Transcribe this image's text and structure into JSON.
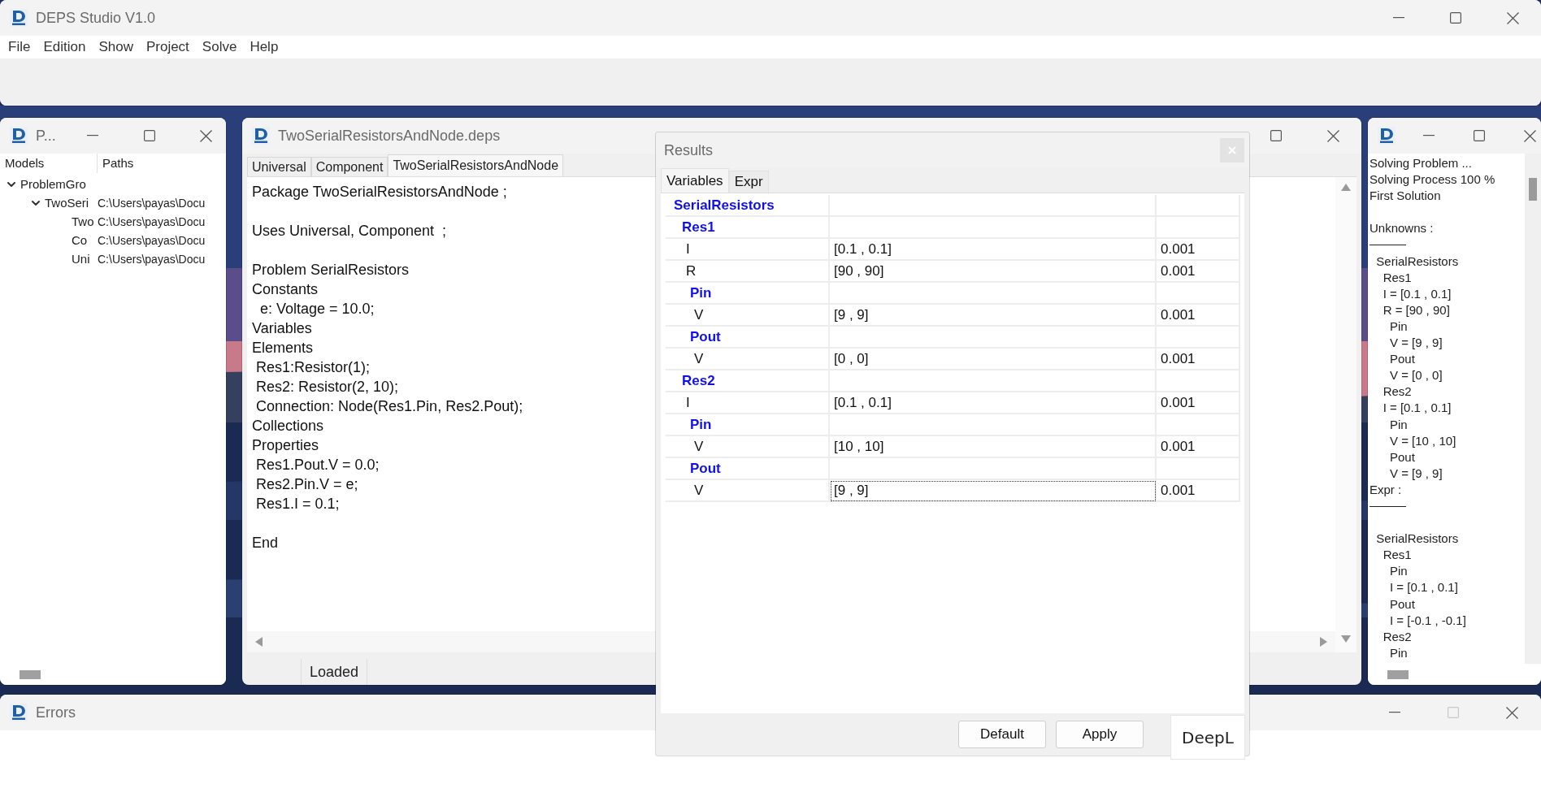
{
  "app": {
    "title": "DEPS Studio V1.0",
    "controls": [
      {
        "kind": "minimize",
        "disabled": false
      },
      {
        "kind": "maximize",
        "disabled": false
      },
      {
        "kind": "close",
        "disabled": false
      }
    ],
    "menu": [
      "File",
      "Edition",
      "Show",
      "Project",
      "Solve",
      "Help"
    ]
  },
  "project_window": {
    "title": "P...",
    "controls": [
      {
        "kind": "minimize",
        "disabled": false
      },
      {
        "kind": "maximize",
        "disabled": false
      },
      {
        "kind": "close",
        "disabled": false
      }
    ],
    "columns": [
      "Models",
      "Paths"
    ],
    "tree": [
      {
        "label": "ProblemGro",
        "expanded": true,
        "children": [
          {
            "label": "TwoSeri",
            "path": "C:\\Users\\payas\\Docu",
            "expanded": true,
            "children": [
              {
                "label": "Two",
                "path": "C:\\Users\\payas\\Docu"
              },
              {
                "label": "Co",
                "path": "C:\\Users\\payas\\Docu"
              },
              {
                "label": "Uni",
                "path": "C:\\Users\\payas\\Docu"
              }
            ]
          }
        ]
      }
    ]
  },
  "editor_window": {
    "title": "TwoSerialResistorsAndNode.deps",
    "controls": [
      {
        "kind": "maximize",
        "disabled": false
      },
      {
        "kind": "close",
        "disabled": false
      }
    ],
    "tabs": [
      {
        "label": "Universal",
        "selected": false
      },
      {
        "label": "Component",
        "selected": false
      },
      {
        "label": "TwoSerialResistorsAndNode",
        "selected": true
      }
    ],
    "code": [
      {
        "kind": "code",
        "text": "Package TwoSerialResistorsAndNode ;"
      },
      {
        "kind": "blank"
      },
      {
        "kind": "code",
        "text": "Uses Universal, Component  ;"
      },
      {
        "kind": "blank"
      },
      {
        "kind": "code",
        "text": "Problem SerialResistors"
      },
      {
        "kind": "code",
        "text": "Constants"
      },
      {
        "kind": "code",
        "text": "  e: Voltage = 10.0;"
      },
      {
        "kind": "code",
        "text": "Variables"
      },
      {
        "kind": "code",
        "text": "Elements"
      },
      {
        "kind": "code",
        "text": " Res1:Resistor(1);"
      },
      {
        "kind": "code",
        "text": " Res2: Resistor(2, 10);"
      },
      {
        "kind": "code",
        "text": " Connection: Node(Res1.Pin, Res2.Pout);"
      },
      {
        "kind": "code",
        "text": "Collections"
      },
      {
        "kind": "code",
        "text": "Properties"
      },
      {
        "kind": "code",
        "text": " Res1.Pout.V = 0.0;"
      },
      {
        "kind": "code",
        "text": " Res2.Pin.V = e;"
      },
      {
        "kind": "code",
        "text": " Res1.I = 0.1;"
      },
      {
        "kind": "blank"
      },
      {
        "kind": "code",
        "text": "End"
      }
    ],
    "status": "Loaded"
  },
  "results_dialog": {
    "title": "Results",
    "tabs": [
      {
        "label": "Variables",
        "selected": true
      },
      {
        "label": "Expr",
        "selected": false
      }
    ],
    "rows": [
      {
        "kind": "group",
        "name": "SerialResistors",
        "children": [
          {
            "kind": "group",
            "name": "Res1",
            "children": [
              {
                "kind": "variable",
                "name": "I",
                "value": "[0.1 , 0.1]",
                "tolerance": "0.001",
                "focused": false
              },
              {
                "kind": "variable",
                "name": "R",
                "value": "[90 , 90]",
                "tolerance": "0.001",
                "focused": false
              },
              {
                "kind": "group",
                "name": "Pin",
                "children": [
                  {
                    "kind": "variable",
                    "name": "V",
                    "value": "[9 , 9]",
                    "tolerance": "0.001",
                    "focused": false
                  }
                ]
              },
              {
                "kind": "group",
                "name": "Pout",
                "children": [
                  {
                    "kind": "variable",
                    "name": "V",
                    "value": "[0 , 0]",
                    "tolerance": "0.001",
                    "focused": false
                  }
                ]
              }
            ]
          },
          {
            "kind": "group",
            "name": "Res2",
            "children": [
              {
                "kind": "variable",
                "name": "I",
                "value": "[0.1 , 0.1]",
                "tolerance": "0.001",
                "focused": false
              },
              {
                "kind": "group",
                "name": "Pin",
                "children": [
                  {
                    "kind": "variable",
                    "name": "V",
                    "value": "[10 , 10]",
                    "tolerance": "0.001",
                    "focused": false
                  }
                ]
              },
              {
                "kind": "group",
                "name": "Pout",
                "children": [
                  {
                    "kind": "variable",
                    "name": "V",
                    "value": "[9 , 9]",
                    "tolerance": "0.001",
                    "focused": true
                  }
                ]
              }
            ]
          }
        ]
      }
    ],
    "buttons": [
      "Default",
      "Apply"
    ],
    "popup": "DeepL"
  },
  "output_window": {
    "controls": [
      {
        "kind": "minimize",
        "disabled": false
      },
      {
        "kind": "maximize",
        "disabled": false
      },
      {
        "kind": "close",
        "disabled": false
      }
    ],
    "lines": [
      {
        "kind": "text",
        "text": "Solving Problem ..."
      },
      {
        "kind": "text",
        "text": "Solving Process 100 %"
      },
      {
        "kind": "text",
        "text": "First Solution"
      },
      {
        "kind": "blank"
      },
      {
        "kind": "text",
        "text": "Unknowns :"
      },
      {
        "kind": "rule"
      },
      {
        "kind": "text",
        "text": "  SerialResistors"
      },
      {
        "kind": "text",
        "text": "    Res1"
      },
      {
        "kind": "text",
        "text": "    I = [0.1 , 0.1]"
      },
      {
        "kind": "text",
        "text": "    R = [90 , 90]"
      },
      {
        "kind": "text",
        "text": "      Pin"
      },
      {
        "kind": "text",
        "text": "      V = [9 , 9]"
      },
      {
        "kind": "text",
        "text": "      Pout"
      },
      {
        "kind": "text",
        "text": "      V = [0 , 0]"
      },
      {
        "kind": "text",
        "text": "    Res2"
      },
      {
        "kind": "text",
        "text": "    I = [0.1 , 0.1]"
      },
      {
        "kind": "text",
        "text": "      Pin"
      },
      {
        "kind": "text",
        "text": "      V = [10 , 10]"
      },
      {
        "kind": "text",
        "text": "      Pout"
      },
      {
        "kind": "text",
        "text": "      V = [9 , 9]"
      },
      {
        "kind": "text",
        "text": "Expr :"
      },
      {
        "kind": "rule"
      },
      {
        "kind": "blank"
      },
      {
        "kind": "text",
        "text": "  SerialResistors"
      },
      {
        "kind": "text",
        "text": "    Res1"
      },
      {
        "kind": "text",
        "text": "      Pin"
      },
      {
        "kind": "text",
        "text": "      I = [0.1 , 0.1]"
      },
      {
        "kind": "text",
        "text": "      Pout"
      },
      {
        "kind": "text",
        "text": "      I = [-0.1 , -0.1]"
      },
      {
        "kind": "text",
        "text": "    Res2"
      },
      {
        "kind": "text",
        "text": "      Pin"
      }
    ]
  },
  "errors_window": {
    "title": "Errors",
    "controls": [
      {
        "kind": "minimize",
        "disabled": false
      },
      {
        "kind": "maximize",
        "disabled": true
      },
      {
        "kind": "close",
        "disabled": false
      }
    ]
  }
}
